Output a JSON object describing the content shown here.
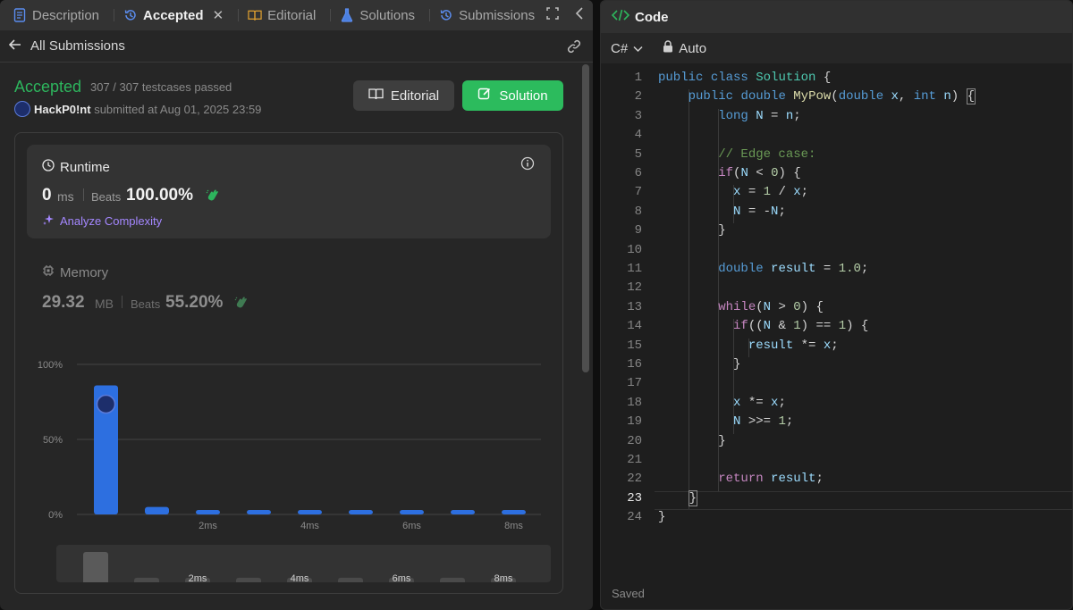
{
  "tabs": [
    {
      "label": "Description",
      "icon": "document-icon",
      "active": false
    },
    {
      "label": "Accepted",
      "icon": "history-icon",
      "active": true
    },
    {
      "label": "Editorial",
      "icon": "book-icon",
      "active": false
    },
    {
      "label": "Solutions",
      "icon": "flask-icon",
      "active": false
    },
    {
      "label": "Submissions",
      "icon": "history-icon",
      "active": false
    }
  ],
  "subheader": {
    "back_label": "All Submissions"
  },
  "result": {
    "status": "Accepted",
    "testcases": "307 / 307 testcases passed",
    "username": "HackP0!nt",
    "submitted_text": "submitted at Aug 01, 2025 23:59"
  },
  "buttons": {
    "editorial": "Editorial",
    "solution": "Solution"
  },
  "runtime": {
    "title": "Runtime",
    "value": "0",
    "unit": "ms",
    "beats_label": "Beats",
    "beats_pct": "100.00%",
    "analyze_label": "Analyze Complexity"
  },
  "memory": {
    "title": "Memory",
    "value": "29.32",
    "unit": "MB",
    "beats_label": "Beats",
    "beats_pct": "55.20%"
  },
  "chart_data": {
    "type": "bar",
    "y_tick_labels": [
      "100%",
      "50%",
      "0%"
    ],
    "ylim": [
      0,
      100
    ],
    "x_tick_labels": [
      "2ms",
      "4ms",
      "6ms",
      "8ms"
    ],
    "values": [
      86,
      5,
      3,
      3,
      3,
      3,
      3,
      3,
      3
    ],
    "highlight_index": 0,
    "bar_color": "#2d6fe0",
    "mini_values": [
      100,
      15,
      15,
      15,
      15,
      15,
      15,
      15,
      15
    ]
  },
  "editor": {
    "title": "Code",
    "language": "C#",
    "mode": "Auto",
    "status": "Saved",
    "current_line": 23,
    "lines": [
      "public class Solution {",
      "    public double MyPow(double x, int n) {",
      "        long N = n;",
      "",
      "        // Edge case:",
      "        if(N < 0) {",
      "          x = 1 / x;",
      "          N = -N;",
      "        }",
      "",
      "        double result = 1.0;",
      "",
      "        while(N > 0) {",
      "          if((N & 1) == 1) {",
      "            result *= x;",
      "          }",
      "",
      "          x *= x;",
      "          N >>= 1;",
      "        }",
      "",
      "        return result;",
      "    }",
      "}"
    ]
  },
  "colors": {
    "accepted": "#2db55d",
    "solution_button": "#2cbb5d",
    "accent_purple": "#a487ff"
  }
}
